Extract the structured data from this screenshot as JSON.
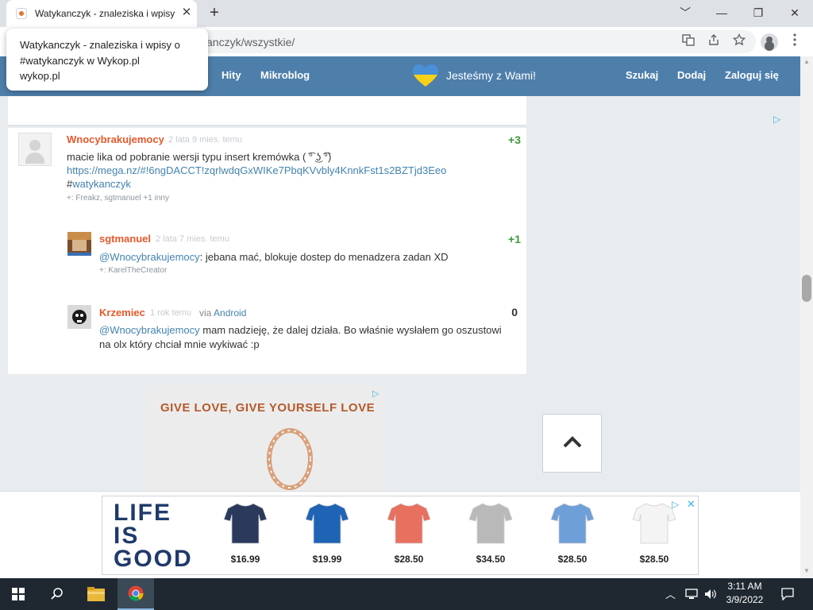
{
  "browser": {
    "tab_title": "Watykanczyk - znaleziska i wpisy",
    "tab_close": "✕",
    "new_tab": "+",
    "url": "anczyk/wszystkie/",
    "window_minimize": "﹀",
    "window_min": "—",
    "window_restore": "❐",
    "window_close": "✕"
  },
  "tooltip": {
    "title": "Watykanczyk - znaleziska i wpisy o #watykanczyk w Wykop.pl",
    "domain": "wykop.pl"
  },
  "nav": {
    "hity": "Hity",
    "mikroblog": "Mikroblog",
    "slogan": "Jesteśmy z Wami!",
    "szukaj": "Szukaj",
    "dodaj": "Dodaj",
    "zaloguj": "Zaloguj się",
    "heart_colors": [
      "#4a8fd8",
      "#f7d117"
    ]
  },
  "post": {
    "author": "Wnocybrakujemocy",
    "date": "2 lata 9 mies. temu",
    "votes": "+3",
    "text_line1": "macie lika od pobranie wersji typu insert kremówka ( ͡° ͜ʖ ͡°)",
    "link": "https://mega.nz/#!6ngDACCT!zqrlwdqGxWIKe7PbqKVvbly4KnnkFst1s2BZTjd3Eeo",
    "hash": "#",
    "tag": "watykanczyk",
    "plus_line": "+: Freakz, sgtmanuel +1 inny"
  },
  "comments": [
    {
      "author": "sgtmanuel",
      "date": "2 lata 7 mies. temu",
      "votes": "+1",
      "mention": "@Wnocybrakujemocy",
      "text": ": jebana mać, blokuje dostep do menadzera zadan XD",
      "plus_line": "+: KarelTheCreator"
    },
    {
      "author": "Krzemiec",
      "date": "1 rok temu",
      "via": "via",
      "via_app": "Android",
      "votes": "0",
      "mention": "@Wnocybrakujemocy",
      "text_line1": " mam nadzieję, że dalej działa. Bo właśnie wysłałem go oszustowi",
      "text_line2": "na olx który chciał mnie wykiwać :p"
    }
  ],
  "ad": {
    "headline": "GIVE LOVE, GIVE YOURSELF LOVE"
  },
  "bottom_ad": {
    "logo_lines": [
      "LIFE",
      "IS",
      "GOOD"
    ],
    "products": [
      {
        "price": "$16.99",
        "color": "#2b3a5c"
      },
      {
        "price": "$19.99",
        "color": "#1f63b5"
      },
      {
        "price": "$28.50",
        "color": "#e8705f"
      },
      {
        "price": "$34.50",
        "color": "#b9b9b9"
      },
      {
        "price": "$28.50",
        "color": "#6f9fd8"
      },
      {
        "price": "$28.50",
        "color": "#f4f4f4"
      }
    ]
  },
  "taskbar": {
    "time": "3:11 AM",
    "date": "3/9/2022"
  },
  "colors": {
    "nav_bg": "#4e7fab",
    "author": "#e6582b",
    "link": "#4383af",
    "vote_positive": "#3c9a3a"
  }
}
